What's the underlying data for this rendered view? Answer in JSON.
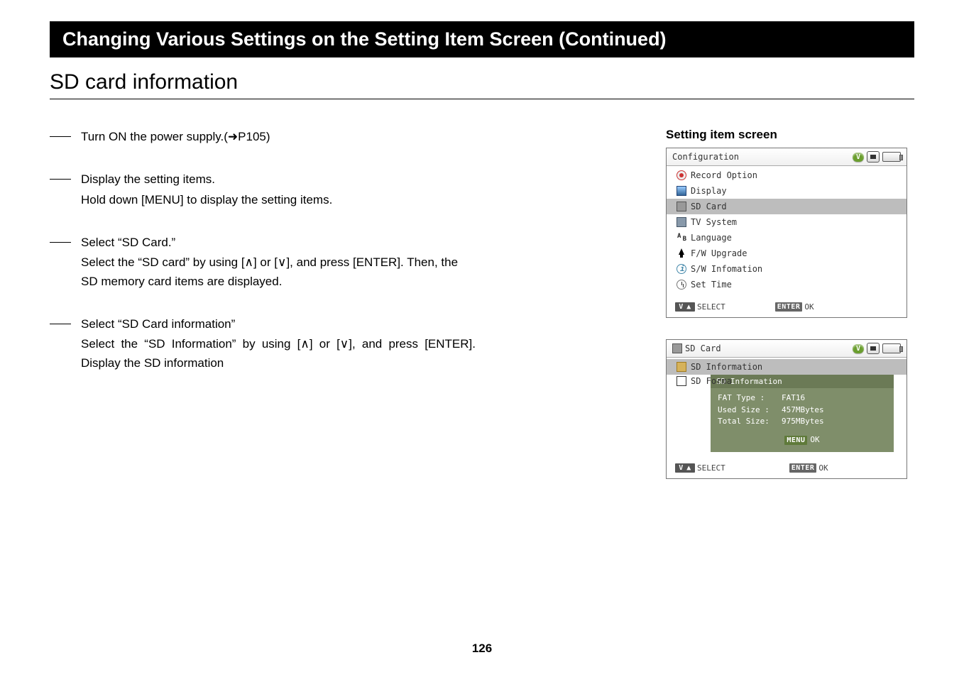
{
  "banner": "Changing Various Settings on the Setting Item Screen (Continued)",
  "section_title": "SD card information",
  "steps": {
    "s1": "Turn ON the power supply.(➜P105)",
    "s2_title": "Display the setting items.",
    "s2_desc": "Hold down [MENU] to display the setting items.",
    "s3_title": "Select “SD Card.”",
    "s3_desc": "Select the “SD card” by using [∧] or [∨], and press [ENTER]. Then, the SD memory card items are displayed.",
    "s4_title": "Select “SD Card information”",
    "s4_desc": "Select the “SD Information” by using [∧] or [∨], and press [ENTER]. Display the SD information"
  },
  "screen_caption": "Setting item screen",
  "screen1": {
    "title": "Configuration",
    "items": [
      "Record Option",
      "Display",
      "SD Card",
      "TV System",
      "Language",
      "F/W Upgrade",
      "S/W Infomation",
      "Set Time"
    ],
    "footer_select": "SELECT",
    "footer_enter": "ENTER",
    "footer_ok": "OK"
  },
  "screen2": {
    "title": "SD Card",
    "row1": "SD Information",
    "row2": "SD Forma",
    "popup_title": "SD Information",
    "fat_k": "FAT Type  :",
    "fat_v": "FAT16",
    "used_k": "Used Size :",
    "used_v": "457MBytes",
    "total_k": "Total Size:",
    "total_v": "975MBytes",
    "menu_btn": "MENU",
    "menu_ok": "OK",
    "footer_select": "SELECT",
    "footer_enter": "ENTER",
    "footer_ok": "OK"
  },
  "page_number": "126"
}
